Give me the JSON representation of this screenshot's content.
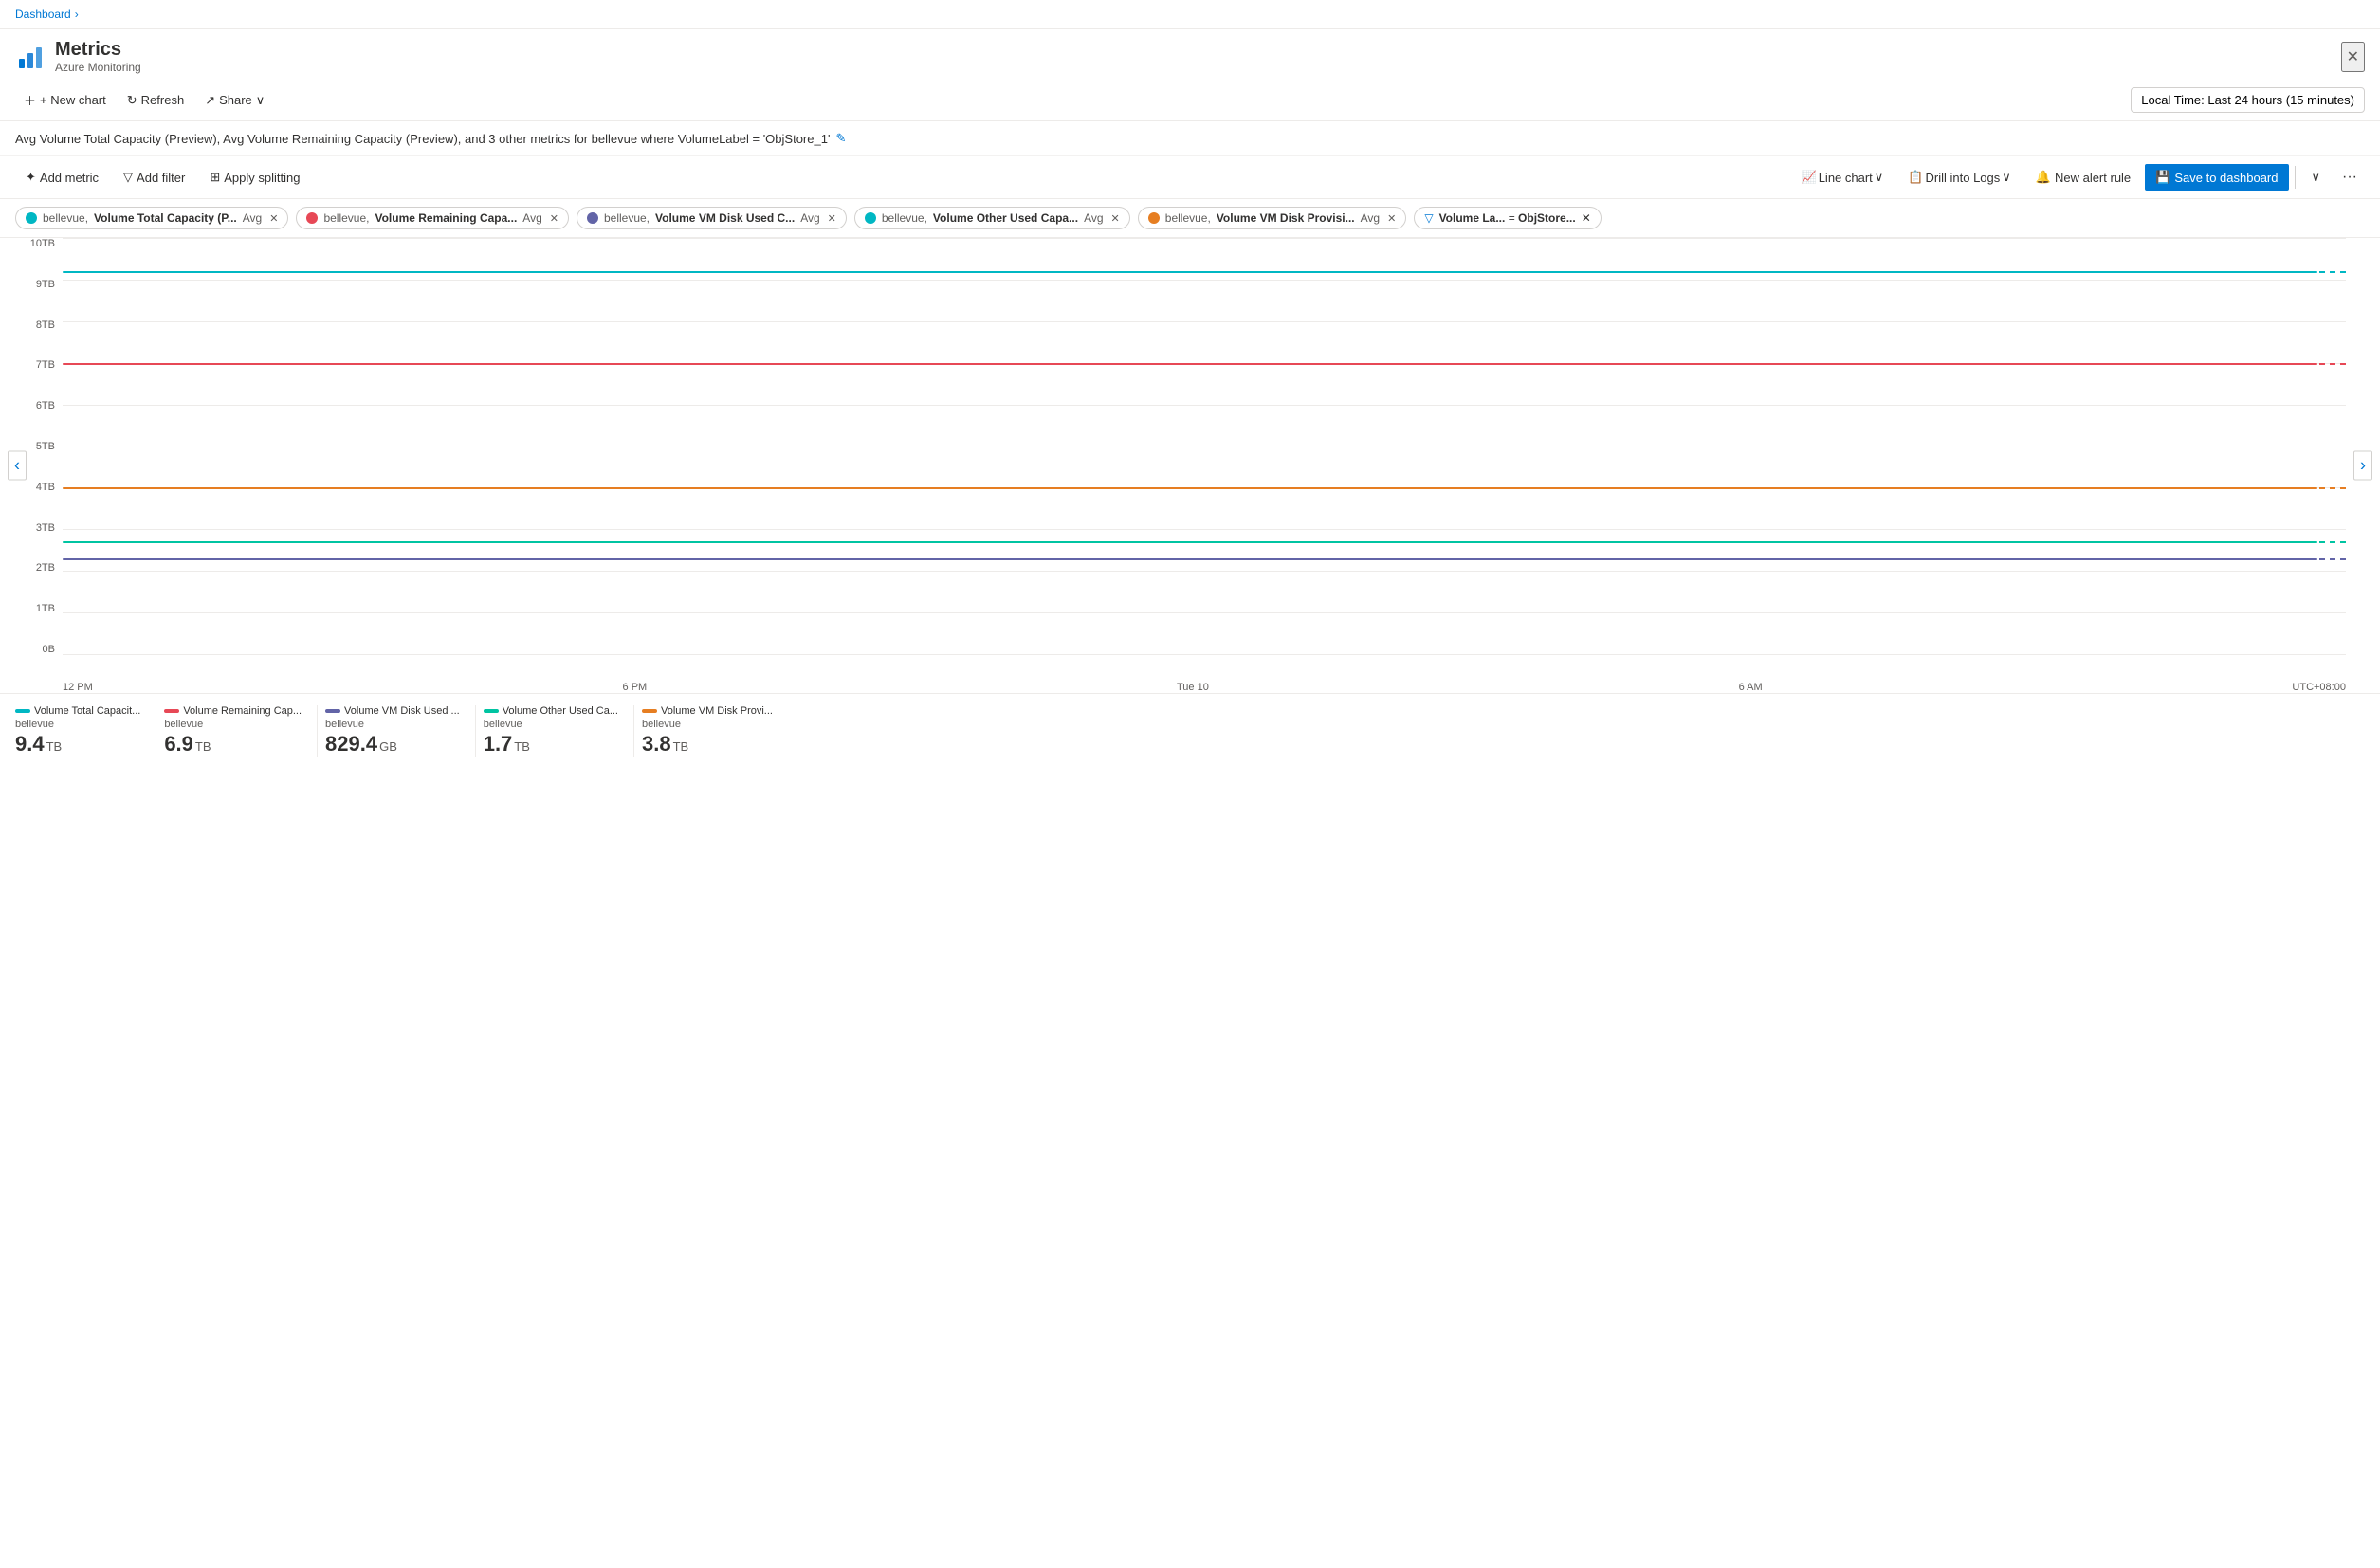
{
  "breadcrumb": {
    "label": "Dashboard",
    "arrow": "›"
  },
  "header": {
    "title": "Metrics",
    "subtitle": "Azure Monitoring",
    "close_label": "✕"
  },
  "toolbar": {
    "new_chart": "+ New chart",
    "refresh": "Refresh",
    "share": "Share",
    "share_arrow": "∨",
    "time_range": "Local Time: Last 24 hours (15 minutes)"
  },
  "chart_title": "Avg Volume Total Capacity (Preview), Avg Volume Remaining Capacity (Preview), and 3 other metrics for bellevue where VolumeLabel = 'ObjStore_1'",
  "metric_toolbar": {
    "add_metric": "Add metric",
    "add_filter": "Add filter",
    "apply_splitting": "Apply splitting",
    "line_chart": "Line chart",
    "drill_logs": "Drill into Logs",
    "new_alert": "New alert rule",
    "save_dashboard": "Save to dashboard",
    "more": "···"
  },
  "tags": [
    {
      "id": "t1",
      "color": "#00b7c3",
      "prefix": "bellevue,",
      "name": "Volume Total Capacity (P...",
      "suffix": "Avg"
    },
    {
      "id": "t2",
      "color": "#e74856",
      "prefix": "bellevue,",
      "name": "Volume Remaining Capa...",
      "suffix": "Avg"
    },
    {
      "id": "t3",
      "color": "#6264a7",
      "prefix": "bellevue,",
      "name": "Volume VM Disk Used C...",
      "suffix": "Avg"
    },
    {
      "id": "t4",
      "color": "#00b7c3",
      "prefix": "bellevue,",
      "name": "Volume Other Used Capa...",
      "suffix": "Avg"
    },
    {
      "id": "t5",
      "color": "#e67e22",
      "prefix": "bellevue,",
      "name": "Volume VM Disk Provisi...",
      "suffix": "Avg"
    }
  ],
  "filter_tag": {
    "label": "Volume La...",
    "op": "=",
    "value": "ObjStore..."
  },
  "y_axis": [
    "10TB",
    "9TB",
    "8TB",
    "7TB",
    "6TB",
    "5TB",
    "4TB",
    "3TB",
    "2TB",
    "1TB",
    "0B"
  ],
  "x_axis": [
    "12 PM",
    "6 PM",
    "Tue 10",
    "6 AM",
    "UTC+08:00"
  ],
  "chart_lines": [
    {
      "color": "#00b7c3",
      "top_pct": 8,
      "dashed_color": "#00b7c3"
    },
    {
      "color": "#e74856",
      "top_pct": 30,
      "dashed_color": "#e74856"
    },
    {
      "color": "#e67e22",
      "top_pct": 60,
      "dashed_color": "#e67e22"
    },
    {
      "color": "#00c4a2",
      "top_pct": 73,
      "dashed_color": "#00c4a2"
    },
    {
      "color": "#6264a7",
      "top_pct": 77,
      "dashed_color": "#6264a7"
    }
  ],
  "legend": [
    {
      "color": "#00b7c3",
      "label": "Volume Total Capacit...",
      "sub": "bellevue",
      "value": "9.4",
      "unit": "TB"
    },
    {
      "color": "#e74856",
      "label": "Volume Remaining Cap...",
      "sub": "bellevue",
      "value": "6.9",
      "unit": "TB"
    },
    {
      "color": "#6264a7",
      "label": "Volume VM Disk Used ...",
      "sub": "bellevue",
      "value": "829.4",
      "unit": "GB"
    },
    {
      "color": "#00c4a2",
      "label": "Volume Other Used Ca...",
      "sub": "bellevue",
      "value": "1.7",
      "unit": "TB"
    },
    {
      "color": "#e67e22",
      "label": "Volume VM Disk Provi...",
      "sub": "bellevue",
      "value": "3.8",
      "unit": "TB"
    }
  ]
}
